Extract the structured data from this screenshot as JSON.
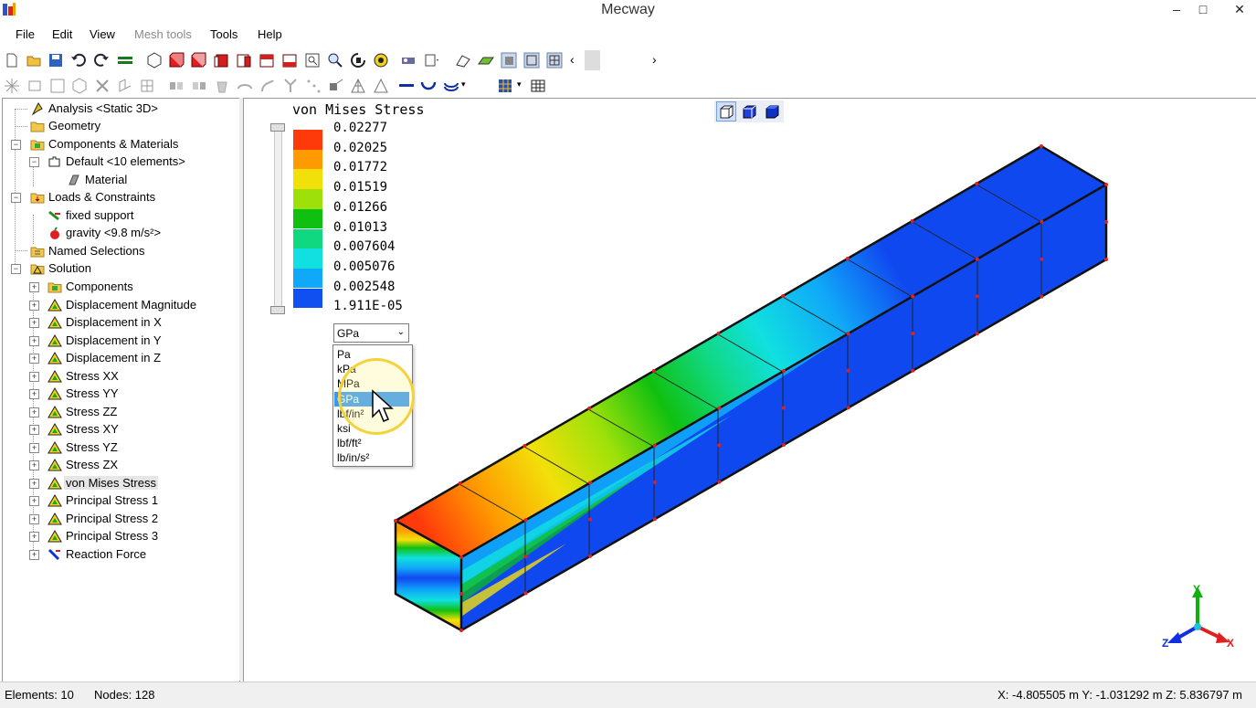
{
  "window": {
    "title": "Mecway",
    "min": "–",
    "max": "□",
    "close": "✕"
  },
  "menu": [
    {
      "label": "File",
      "enabled": true
    },
    {
      "label": "Edit",
      "enabled": true
    },
    {
      "label": "View",
      "enabled": true
    },
    {
      "label": "Mesh tools",
      "enabled": false
    },
    {
      "label": "Tools",
      "enabled": true
    },
    {
      "label": "Help",
      "enabled": true
    }
  ],
  "tree": {
    "analysis": "Analysis <Static 3D>",
    "geometry": "Geometry",
    "components_materials": "Components & Materials",
    "default": "Default <10 elements>",
    "material": "Material",
    "loads_constraints": "Loads & Constraints",
    "fixed_support": "fixed support",
    "gravity": "gravity <9.8 m/s²>",
    "named_selections": "Named Selections",
    "solution": "Solution",
    "solution_items": [
      "Components",
      "Displacement Magnitude",
      "Displacement in X",
      "Displacement in Y",
      "Displacement in Z",
      "Stress XX",
      "Stress YY",
      "Stress ZZ",
      "Stress XY",
      "Stress YZ",
      "Stress ZX",
      "von Mises Stress",
      "Principal Stress 1",
      "Principal Stress 2",
      "Principal Stress 3",
      "Reaction Force"
    ],
    "selected": "von Mises Stress"
  },
  "legend": {
    "title": "von Mises Stress",
    "labels": [
      "0.02277",
      "0.02025",
      "0.01772",
      "0.01519",
      "0.01266",
      "0.01013",
      "0.007604",
      "0.005076",
      "0.002548",
      "1.911E-05"
    ],
    "colors": [
      "#ff3a0a",
      "#ff9a00",
      "#f2e00a",
      "#9ee10a",
      "#10c010",
      "#10d880",
      "#10e0e0",
      "#10a8f8",
      "#1050f0"
    ]
  },
  "units": {
    "selected": "GPa",
    "options": [
      "Pa",
      "kPa",
      "MPa",
      "GPa",
      "lbf/in²",
      "ksi",
      "lbf/ft²",
      "lb/in/s²"
    ],
    "highlighted_index": 3
  },
  "status": {
    "elements": "Elements: 10",
    "nodes": "Nodes: 128",
    "coords": "X: -4.805505 m Y: -1.031292 m Z: 5.836797 m"
  },
  "axes": {
    "x": "X",
    "y": "Y",
    "z": "Z"
  },
  "colors": {
    "selection": "#3399ff",
    "beam_blue": "#1048f0"
  }
}
